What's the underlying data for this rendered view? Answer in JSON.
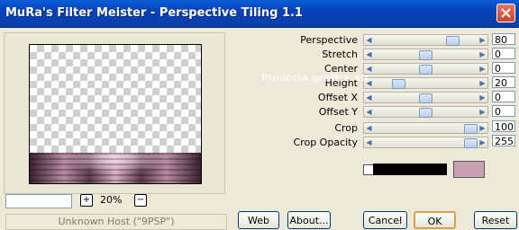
{
  "window": {
    "title": "MuRa's Filter Meister - Perspective Tiling 1.1"
  },
  "preview": {
    "zoom": "20%",
    "zoom_plus": "+",
    "zoom_minus": "−",
    "status": "Unknown Host (\"9PSP\")"
  },
  "params": [
    {
      "label": "Perspective",
      "value": "80",
      "level": 80
    },
    {
      "label": "Stretch",
      "value": "0",
      "level": 50
    },
    {
      "label": "Center",
      "value": "0",
      "level": 50
    },
    {
      "label": "Height",
      "value": "20",
      "level": 20
    },
    {
      "label": "Offset X",
      "value": "0",
      "level": 50
    },
    {
      "label": "Offset Y",
      "value": "0",
      "level": 50
    },
    {
      "label": "Crop",
      "value": "100",
      "level": 100
    },
    {
      "label": "Crop Opacity",
      "value": "255",
      "level": 100
    }
  ],
  "colors": {
    "background_swatch": "#ffffff",
    "fill_swatch": "#000000",
    "tile_color": "#c8a0b4"
  },
  "buttons": {
    "web": "Web",
    "about": "About...",
    "cancel": "Cancel",
    "ok": "OK",
    "reset": "Reset"
  },
  "watermark": {
    "text": "Pinuccia.grafica.eu"
  }
}
